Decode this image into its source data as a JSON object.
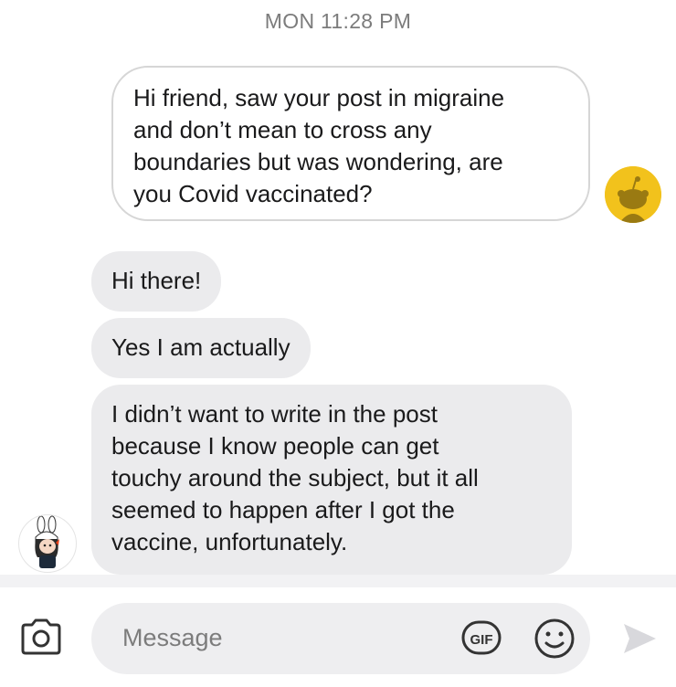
{
  "timestamp": "MON 11:28 PM",
  "messages": [
    {
      "direction": "outgoing",
      "lines": [
        "Hi friend, saw your post in migraine",
        "and don’t mean to cross any",
        "boundaries but was wondering, are",
        "you Covid vaccinated?"
      ]
    },
    {
      "direction": "incoming",
      "lines": [
        "Hi there!"
      ]
    },
    {
      "direction": "incoming",
      "lines": [
        "Yes I am actually"
      ]
    },
    {
      "direction": "incoming",
      "lines": [
        "I didn’t want to write in the post",
        "because I know people can get",
        "touchy around the subject, but it all",
        "seemed to happen after I got the",
        "vaccine, unfortunately."
      ]
    }
  ],
  "composer": {
    "placeholder": "Message",
    "gif_label": "GIF"
  },
  "icons": {
    "camera": "camera-icon",
    "gif": "gif-icon",
    "emoji": "emoji-icon",
    "send": "send-icon"
  },
  "colors": {
    "incoming_bubble": "#ebebed",
    "outgoing_border": "#d6d6d6",
    "avatar_yellow": "#f2c21c",
    "muted_text": "#7c7c7c"
  }
}
